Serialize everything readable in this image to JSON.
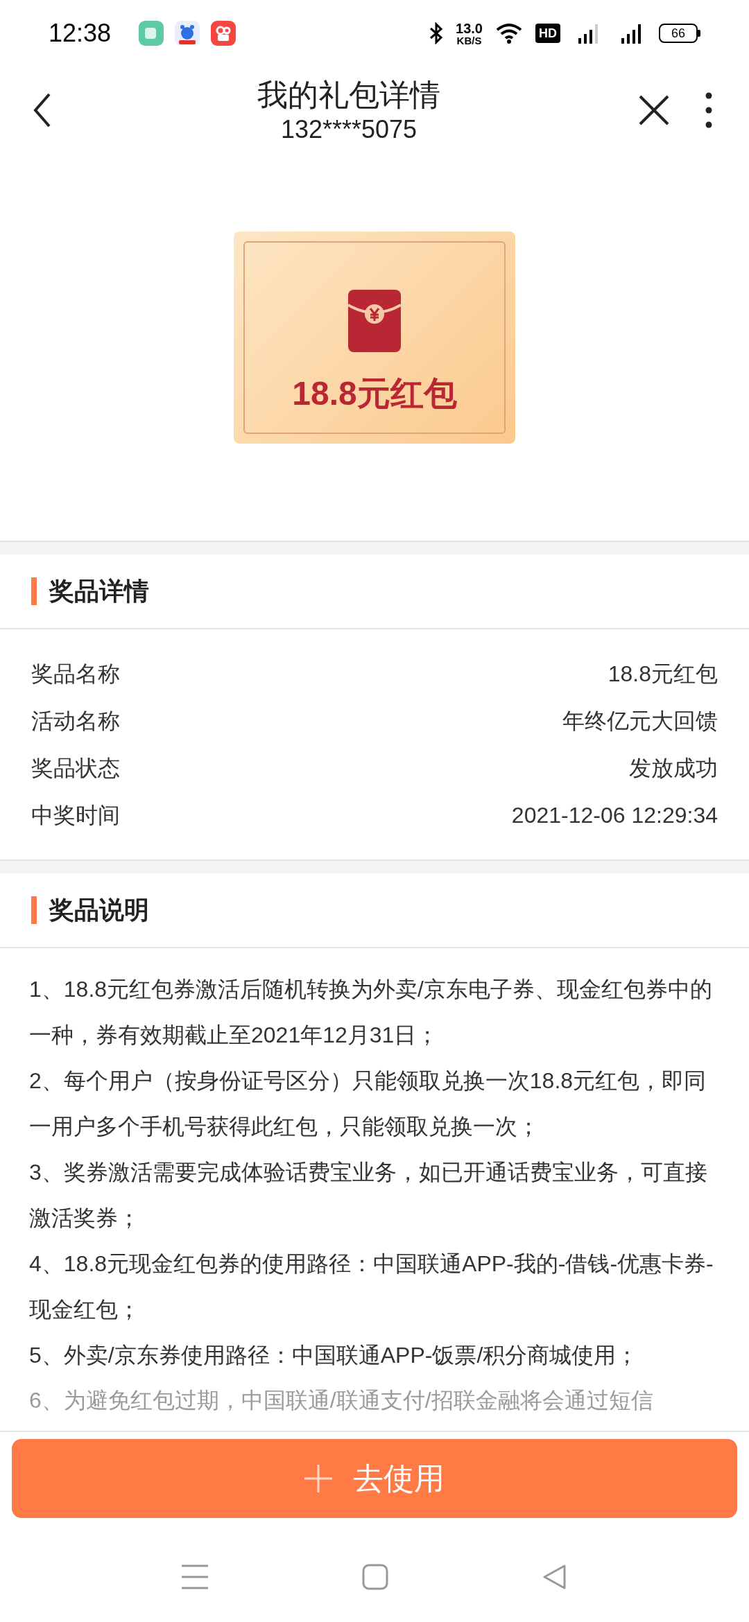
{
  "status_bar": {
    "time": "12:38",
    "speed_value": "13.0",
    "speed_unit": "KB/S",
    "hd": "HD",
    "battery": "66"
  },
  "header": {
    "title": "我的礼包详情",
    "subtitle": "132****5075"
  },
  "prize_card": {
    "name": "18.8元红包"
  },
  "details": {
    "title": "奖品详情",
    "rows": [
      {
        "label": "奖品名称",
        "value": "18.8元红包"
      },
      {
        "label": "活动名称",
        "value": "年终亿元大回馈"
      },
      {
        "label": "奖品状态",
        "value": "发放成功"
      },
      {
        "label": "中奖时间",
        "value": "2021-12-06 12:29:34"
      }
    ]
  },
  "description": {
    "title": "奖品说明",
    "items": [
      {
        "text": "1、18.8元红包券激活后随机转换为外卖/京东电子券、现金红包券中的一种，券有效期截止至2021年12月31日；",
        "faded": false
      },
      {
        "text": "2、每个用户（按身份证号区分）只能领取兑换一次18.8元红包，即同一用户多个手机号获得此红包，只能领取兑换一次；",
        "faded": false
      },
      {
        "text": "3、奖券激活需要完成体验话费宝业务，如已开通话费宝业务，可直接激活奖券；",
        "faded": false
      },
      {
        "text": "4、18.8元现金红包券的使用路径：中国联通APP-我的-借钱-优惠卡券-现金红包；",
        "faded": false
      },
      {
        "text": "5、外卖/京东券使用路径：中国联通APP-饭票/积分商城使用；",
        "faded": false
      },
      {
        "text": "6、为避免红包过期，中国联通/联通支付/招联金融将会通过短信",
        "faded": true
      }
    ]
  },
  "action_button": {
    "label": "去使用"
  }
}
